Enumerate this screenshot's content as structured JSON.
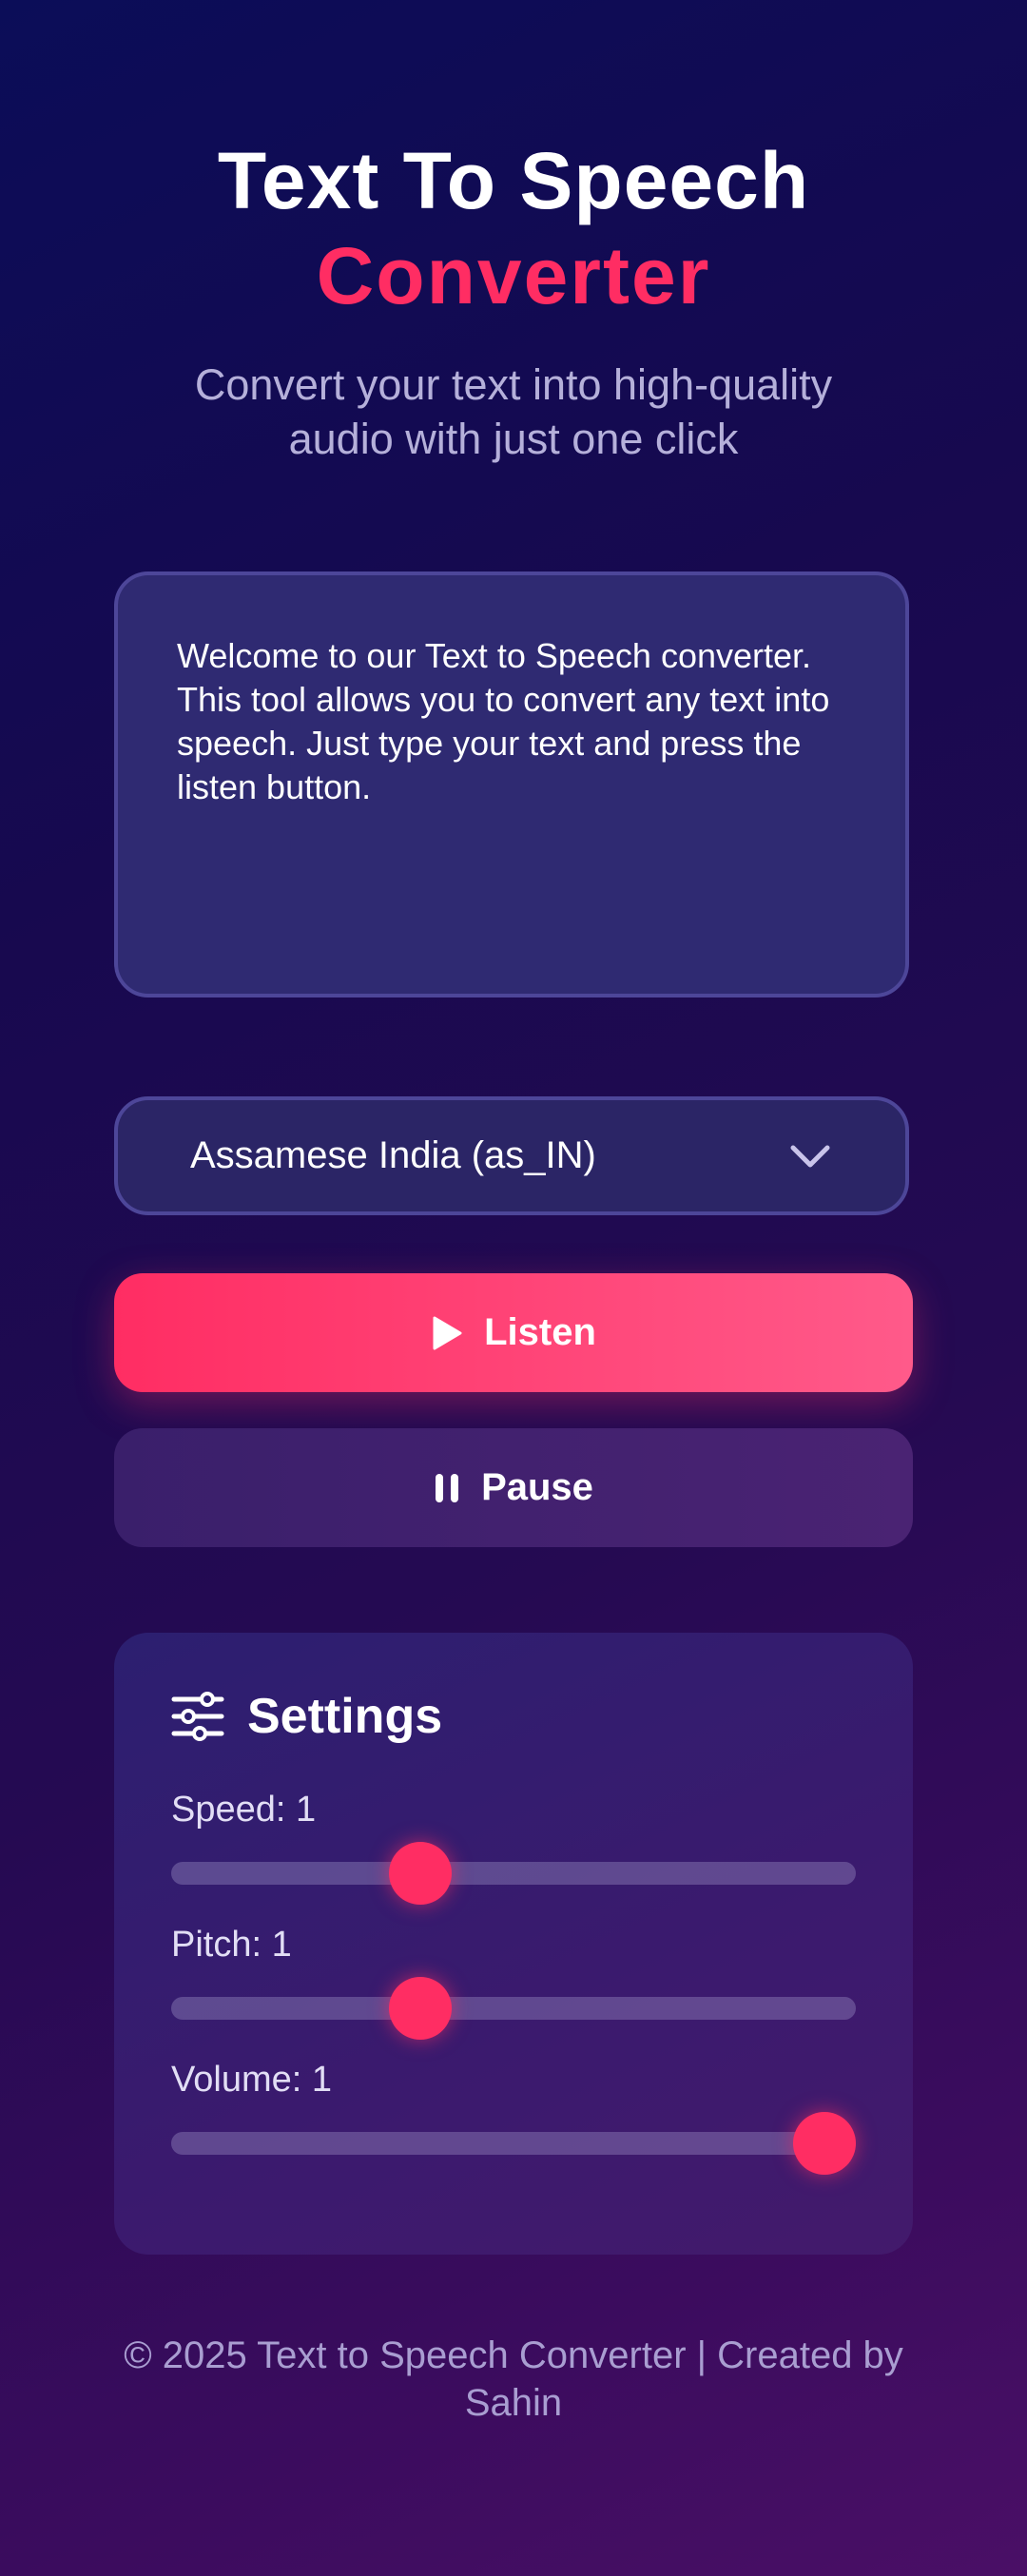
{
  "header": {
    "title_line1": "Text To Speech",
    "title_line2": "Converter",
    "subtitle": "Convert your text into high-quality audio with just one click"
  },
  "text_input": {
    "value": "Welcome to our Text to Speech converter. This tool allows you to convert any text into speech. Just type your text and press the listen button."
  },
  "voice_select": {
    "selected": "Assamese India (as_IN)",
    "icon": "chevron-down-icon"
  },
  "buttons": {
    "listen_label": "Listen",
    "listen_icon": "play-icon",
    "pause_label": "Pause",
    "pause_icon": "pause-icon"
  },
  "settings": {
    "title": "Settings",
    "icon": "sliders-icon",
    "sliders": [
      {
        "label": "Speed: 1",
        "value": 1,
        "min": 0.1,
        "max": 3,
        "fraction": 0.35
      },
      {
        "label": "Pitch: 1",
        "value": 1,
        "min": 0.1,
        "max": 3,
        "fraction": 0.35
      },
      {
        "label": "Volume: 1",
        "value": 1,
        "min": 0,
        "max": 1,
        "fraction": 1.0
      }
    ]
  },
  "footer": {
    "text": "© 2025 Text to Speech Converter | Created by Sahin"
  },
  "colors": {
    "accent": "#ff2d63",
    "background_start": "#0b0d58",
    "background_end": "#4a0f66",
    "panel": "#2f2a72"
  }
}
